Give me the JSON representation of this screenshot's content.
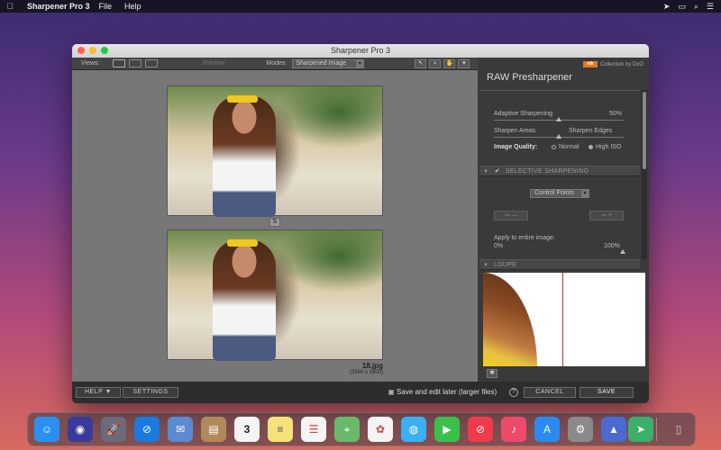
{
  "menubar": {
    "app_name": "Sharpener Pro 3",
    "menus": [
      "File",
      "Help"
    ],
    "right_icons": [
      "location-icon",
      "airplay-icon",
      "search-icon",
      "menu-icon"
    ]
  },
  "window": {
    "title": "Sharpener Pro 3"
  },
  "toolbar": {
    "views_label": "Views:",
    "preview_label": "Preview",
    "modes_label": "Modes:",
    "modes_value": "Sharpened Image"
  },
  "canvas": {
    "file_name": "18.jpg",
    "file_size": "(2560 x 1600)"
  },
  "panel": {
    "logo_mark": "nik",
    "logo_text": "Collection by DxO",
    "title": "RAW Presharpener",
    "adaptive_label": "Adaptive Sharpening",
    "adaptive_value": "50%",
    "adaptive_fraction": 0.5,
    "sharpen_areas_label": "Sharpen Areas",
    "sharpen_edges_label": "Sharpen Edges",
    "image_quality_label": "Image Quality:",
    "quality_options": [
      "Normal",
      "High ISO"
    ],
    "selected_quality": "High ISO",
    "selective_section": "SELECTIVE SHARPENING",
    "control_points_value": "Control Points",
    "apply_label": "Apply to entire image:",
    "apply_min": "0%",
    "apply_max": "100%",
    "loupe_section": "LOUPE"
  },
  "bottom": {
    "help_label": "HELP ▼",
    "settings_label": "SETTINGS",
    "save_later_label": "Save and edit later (larger files)",
    "cancel_label": "CANCEL",
    "save_label": "SAVE"
  },
  "dock": {
    "icons": [
      {
        "name": "finder-icon",
        "color": "#2a8ff0"
      },
      {
        "name": "siri-icon",
        "color": "#3a3a9a"
      },
      {
        "name": "launchpad-icon",
        "color": "#6a6a7a"
      },
      {
        "name": "safari-icon",
        "color": "#1a7ae0"
      },
      {
        "name": "mail-icon",
        "color": "#5a8ad0"
      },
      {
        "name": "contacts-icon",
        "color": "#b08a5a"
      },
      {
        "name": "calendar-icon",
        "color": "#f4f4f4"
      },
      {
        "name": "notes-icon",
        "color": "#f6e27a"
      },
      {
        "name": "reminders-icon",
        "color": "#f4f4f4"
      },
      {
        "name": "maps-icon",
        "color": "#6ab86a"
      },
      {
        "name": "photos-icon",
        "color": "#f4f4f4"
      },
      {
        "name": "messages-icon",
        "color": "#3ab0f0"
      },
      {
        "name": "facetime-icon",
        "color": "#3ac04a"
      },
      {
        "name": "news-icon",
        "color": "#f03a4a"
      },
      {
        "name": "music-icon",
        "color": "#f04a6a"
      },
      {
        "name": "app-store-icon",
        "color": "#2a8af0"
      },
      {
        "name": "system-preferences-icon",
        "color": "#8a8a8a"
      },
      {
        "name": "affinity-icon",
        "color": "#4a6ad0"
      },
      {
        "name": "app-icon",
        "color": "#3ab06a"
      },
      {
        "name": "trash-icon",
        "color": "#8a8a8a"
      }
    ],
    "calendar_day": "3"
  }
}
